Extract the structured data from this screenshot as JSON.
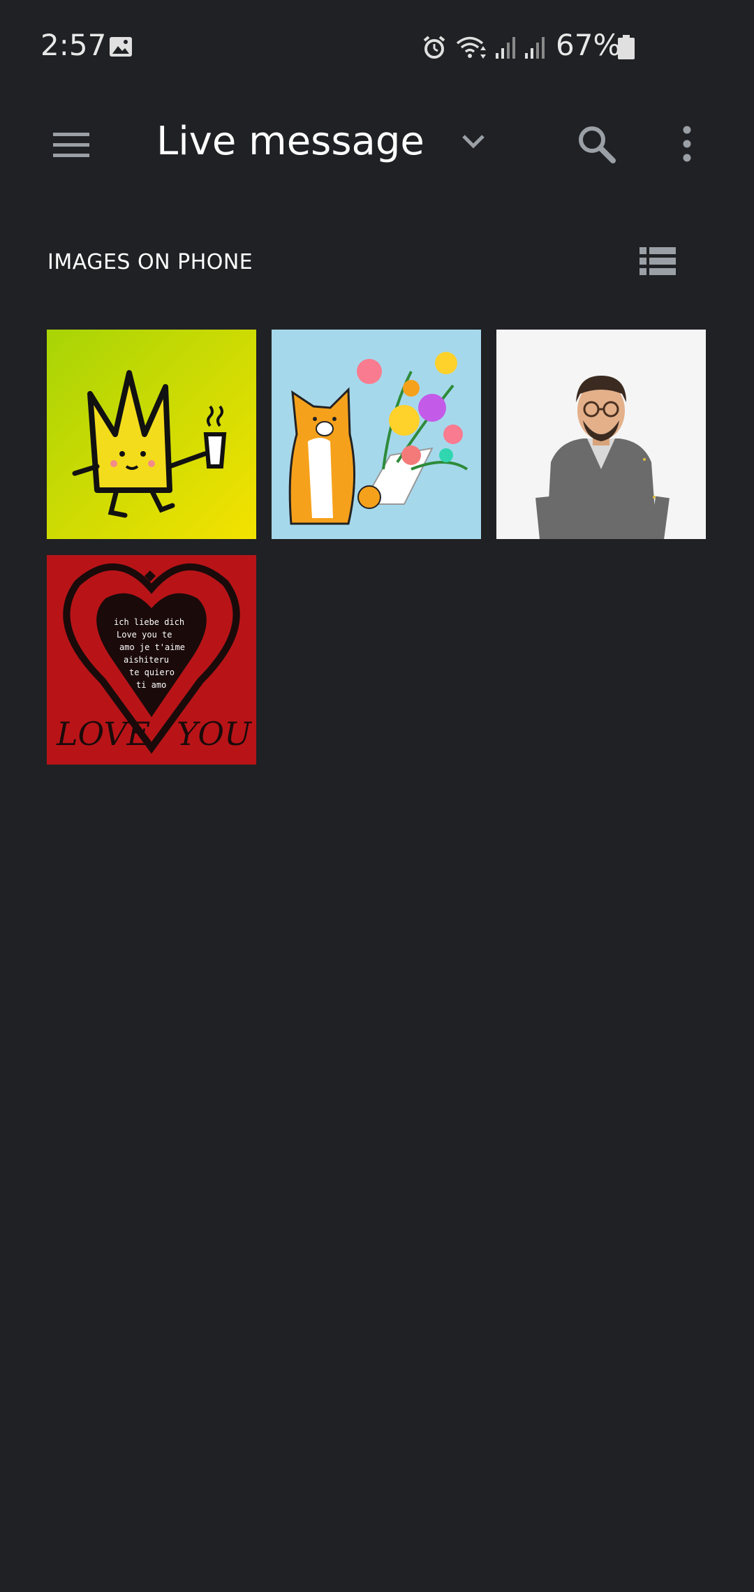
{
  "status_bar": {
    "time": "2:57",
    "battery": "67%",
    "icons": [
      "gallery-icon",
      "alarm-icon",
      "wifi-icon",
      "signal-icon",
      "signal-icon",
      "battery-icon"
    ]
  },
  "app_bar": {
    "title": "Live message",
    "icons": [
      "menu-icon",
      "chevron-down-icon",
      "search-icon",
      "more-vert-icon"
    ]
  },
  "section": {
    "header": "IMAGES ON PHONE",
    "view_icon": "list-view-icon"
  },
  "images": [
    {
      "name": "crown-coffee-sticker",
      "thumb_bg": "#c8dc10"
    },
    {
      "name": "cat-bouquet-sticker",
      "thumb_bg": "#a6d8ec"
    },
    {
      "name": "avatar-sticker",
      "thumb_bg": "#f5f5f5"
    },
    {
      "name": "love-you-heart-sticker",
      "thumb_bg": "#b81418",
      "caption_left": "LOVE",
      "caption_right": "YOU"
    }
  ],
  "colors": {
    "background": "#202124",
    "icon": "#9aa0a6",
    "text": "#ffffff"
  }
}
